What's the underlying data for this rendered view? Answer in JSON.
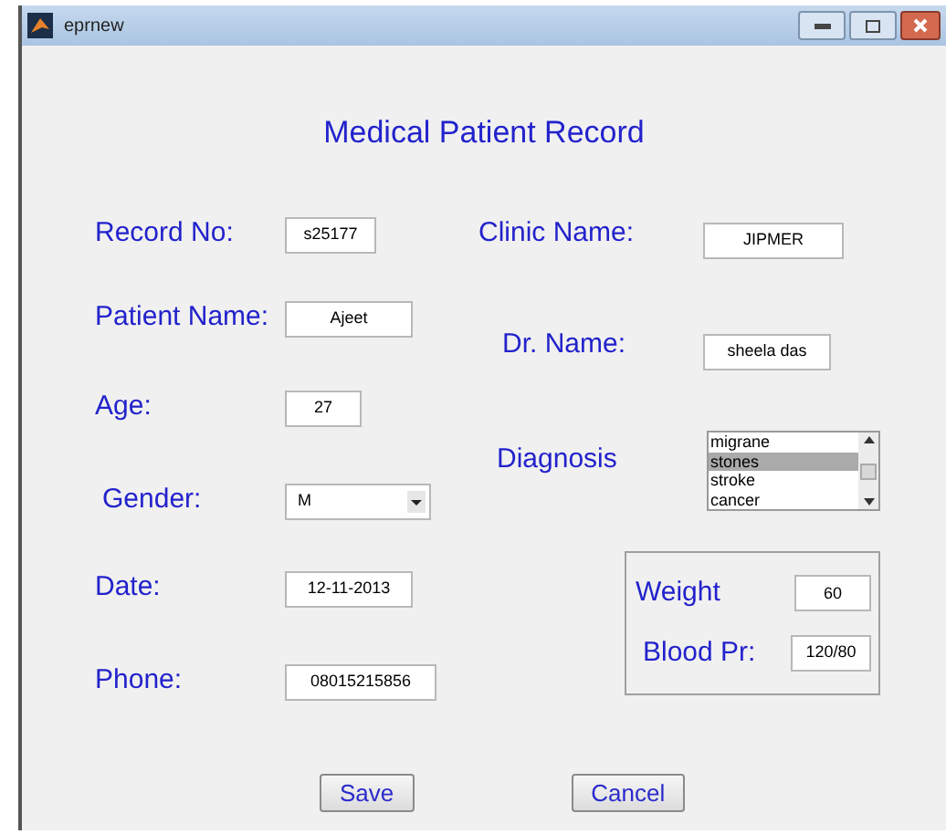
{
  "window": {
    "title": "eprnew"
  },
  "heading": "Medical Patient Record",
  "left_fields": [
    {
      "kind": "text",
      "label": "Record No:",
      "value": "s25177"
    },
    {
      "kind": "text",
      "label": "Patient Name:",
      "value": "Ajeet"
    },
    {
      "kind": "text",
      "label": "Age:",
      "value": "27"
    },
    {
      "kind": "dropdown",
      "label": "Gender:",
      "value": "M"
    },
    {
      "kind": "text",
      "label": "Date:",
      "value": "12-11-2013"
    },
    {
      "kind": "text",
      "label": "Phone:",
      "value": "08015215856"
    }
  ],
  "right_fields": [
    {
      "kind": "text",
      "label": "Clinic Name:",
      "value": "JIPMER"
    },
    {
      "kind": "text",
      "label": "Dr. Name:",
      "value": "sheela das"
    }
  ],
  "diagnosis": {
    "label": "Diagnosis",
    "items": [
      {
        "text": "migrane",
        "selected": false
      },
      {
        "text": "stones",
        "selected": true
      },
      {
        "text": "stroke",
        "selected": false
      },
      {
        "text": "cancer",
        "selected": false
      }
    ]
  },
  "vitals": [
    {
      "label": "Weight",
      "value": "60"
    },
    {
      "label": "Blood Pr:",
      "value": "120/80"
    }
  ],
  "buttons": [
    "Save",
    "Cancel"
  ]
}
